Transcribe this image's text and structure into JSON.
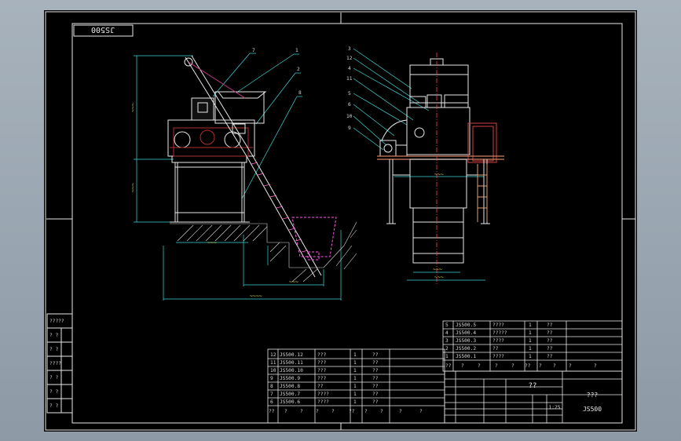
{
  "drawing": {
    "code_box": "JS500",
    "title_block": {
      "name_marks": "??",
      "material_marks": "???",
      "drawing_no": "JS500",
      "scale": "1:25"
    },
    "left_column_marks": [
      "?????",
      "?  ?",
      "?  ?",
      "????",
      "?  ?",
      "?  ?",
      "?  ?"
    ],
    "left_view_callouts": [
      "7",
      "1",
      "2",
      "8"
    ],
    "right_view_callouts": [
      "3",
      "12",
      "4",
      "11",
      "5",
      "6",
      "10",
      "9"
    ],
    "parts_upper": [
      {
        "no": "5",
        "code": "JS500.5",
        "name": "????",
        "qty": "1",
        "note": "??"
      },
      {
        "no": "4",
        "code": "JS500.4",
        "name": "?????",
        "qty": "1",
        "note": "??"
      },
      {
        "no": "3",
        "code": "JS500.3",
        "name": "????",
        "qty": "1",
        "note": "??"
      },
      {
        "no": "2",
        "code": "JS500.2",
        "name": "??",
        "qty": "1",
        "note": "??"
      },
      {
        "no": "1",
        "code": "JS500.1",
        "name": "????",
        "qty": "1",
        "note": "??"
      }
    ],
    "parts_lower": [
      {
        "no": "12",
        "code": "JS500.12",
        "name": "???",
        "qty": "1",
        "note": "??"
      },
      {
        "no": "11",
        "code": "JS500.11",
        "name": "???",
        "qty": "1",
        "note": "??"
      },
      {
        "no": "10",
        "code": "JS500.10",
        "name": "???",
        "qty": "1",
        "note": "??"
      },
      {
        "no": "9",
        "code": "JS500.9",
        "name": "???",
        "qty": "1",
        "note": "??"
      },
      {
        "no": "8",
        "code": "JS500.8",
        "name": "??",
        "qty": "1",
        "note": "??"
      },
      {
        "no": "7",
        "code": "JS500.7",
        "name": "????",
        "qty": "1",
        "note": "??"
      },
      {
        "no": "6",
        "code": "JS500.6",
        "name": "????",
        "qty": "1",
        "note": "??"
      }
    ],
    "header_marks": [
      "??",
      "?",
      "?",
      "?",
      "?",
      "??",
      "?",
      "?",
      "?",
      "?"
    ]
  }
}
